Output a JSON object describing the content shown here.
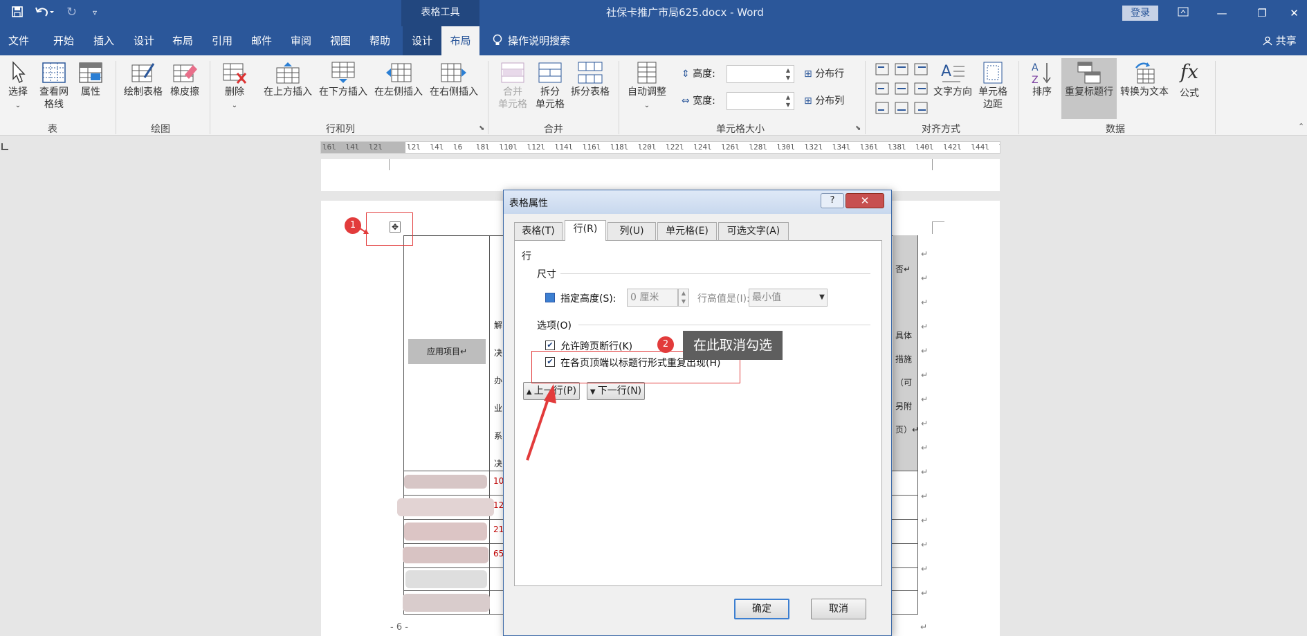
{
  "titlebar": {
    "context_tab": "表格工具",
    "document_title": "社保卡推广市局625.docx - Word",
    "login": "登录"
  },
  "menu": {
    "tabs": [
      "文件",
      "开始",
      "插入",
      "设计",
      "布局",
      "引用",
      "邮件",
      "审阅",
      "视图",
      "帮助",
      "设计",
      "布局"
    ],
    "tell_me": "操作说明搜索",
    "share": "共享"
  },
  "ribbon": {
    "table_group": {
      "label": "表",
      "select": "选择",
      "gridlines": "查看网格线",
      "properties": "属性"
    },
    "draw_group": {
      "label": "绘图",
      "draw_table": "绘制表格",
      "eraser": "橡皮擦"
    },
    "rows_cols_group": {
      "label": "行和列",
      "delete": "删除",
      "insert_above": "在上方插入",
      "insert_below": "在下方插入",
      "insert_left": "在左侧插入",
      "insert_right": "在右侧插入"
    },
    "merge_group": {
      "label": "合并",
      "merge_cells_line1": "合并",
      "merge_cells_line2": "单元格",
      "split_cells_line1": "拆分",
      "split_cells_line2": "单元格",
      "split_table": "拆分表格"
    },
    "cell_size_group": {
      "label": "单元格大小",
      "autofit": "自动调整",
      "height": "高度:",
      "width": "宽度:",
      "distribute_rows": "分布行",
      "distribute_cols": "分布列"
    },
    "alignment_group": {
      "label": "对齐方式",
      "text_direction": "文字方向",
      "cell_margins_line1": "单元格",
      "cell_margins_line2": "边距"
    },
    "data_group": {
      "label": "数据",
      "sort": "排序",
      "repeat_header": "重复标题行",
      "convert_to_text": "转换为文本",
      "formula": "公式"
    }
  },
  "ruler": {
    "left_label": "l6l l4l l2l",
    "mid_label": "l2l l4l l6",
    "right_label": "l8l l10l l12l l14l l16l l18l l20l l22l l24l l26l l28l l30l l32l l34l l36l l38l l40l l42l l44l l46"
  },
  "document": {
    "table_cell_label": "应用项目↵",
    "right_col_text": [
      "否↵",
      "具体",
      "措施",
      "（可",
      "另附",
      "页）↵"
    ],
    "left_col_chars": [
      "解",
      "决",
      "办",
      "业",
      "系",
      "决"
    ],
    "red_numbers": [
      "10",
      "12",
      "21",
      "65"
    ],
    "return_mark": "↵",
    "page_number": "- 6 -"
  },
  "dialog": {
    "title": "表格属性",
    "help": "?",
    "close": "✕",
    "tabs": [
      "表格(T)",
      "行(R)",
      "列(U)",
      "单元格(E)",
      "可选文字(A)"
    ],
    "active_tab": "行(R)",
    "section_row": "行",
    "size_label": "尺寸",
    "specify_height": "指定高度(S):",
    "height_value": "0 厘米",
    "row_height_is": "行高值是(I):",
    "row_height_mode": "最小值",
    "options_label": "选项(O)",
    "allow_break": "允许跨页断行(K)",
    "allow_break_checked": true,
    "repeat_header": "在各页顶端以标题行形式重复出现(H)",
    "repeat_header_checked": true,
    "prev_row": "上一行(P)",
    "next_row": "下一行(N)",
    "ok": "确定",
    "cancel": "取消"
  },
  "annotations": {
    "badge1": "1",
    "badge2": "2",
    "tooltip": "在此取消勾选",
    "accent_color": "#e23b3b"
  }
}
